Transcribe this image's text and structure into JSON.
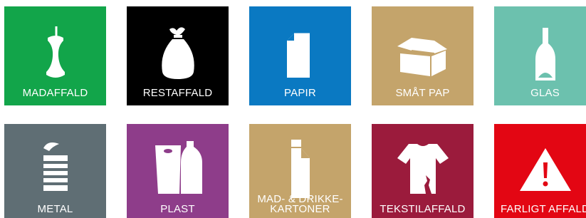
{
  "tiles": [
    {
      "label": "MADAFFALD",
      "icon": "apple-core-icon",
      "color": "#12A54A"
    },
    {
      "label": "RESTAFFALD",
      "icon": "trash-bag-icon",
      "color": "#000000"
    },
    {
      "label": "PAPIR",
      "icon": "paper-sheet-icon",
      "color": "#0A79C2"
    },
    {
      "label": "SMÅT PAP",
      "icon": "cardboard-box-icon",
      "color": "#C4A46B"
    },
    {
      "label": "GLAS",
      "icon": "glass-bottle-icon",
      "color": "#6CC1AE"
    },
    {
      "label": "METAL",
      "icon": "tin-can-icon",
      "color": "#5F6E74"
    },
    {
      "label": "PLAST",
      "icon": "plastic-bag-bottle-icon",
      "color": "#8E3D8A"
    },
    {
      "label_line1": "MAD- & DRIKKE-",
      "label_line2": "KARTONER",
      "icon": "drink-carton-icon",
      "color": "#C4A46B"
    },
    {
      "label": "TEKSTILAFFALD",
      "icon": "torn-shirt-icon",
      "color": "#9B1B3C"
    },
    {
      "label": "FARLIGT AFFALD",
      "icon": "warning-triangle-icon",
      "color": "#E30613"
    }
  ]
}
